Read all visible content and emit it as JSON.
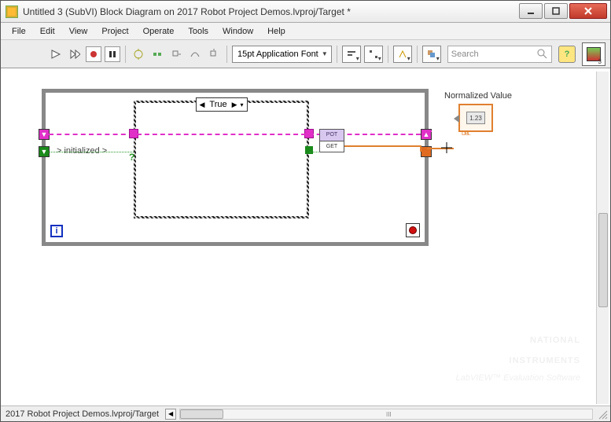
{
  "window": {
    "title": "Untitled 3 (SubVI) Block Diagram on 2017 Robot Project Demos.lvproj/Target *"
  },
  "menu": {
    "file": "File",
    "edit": "Edit",
    "view": "View",
    "project": "Project",
    "operate": "Operate",
    "tools": "Tools",
    "window": "Window",
    "help": "Help"
  },
  "toolbar": {
    "font": "15pt Application Font",
    "search_placeholder": "Search",
    "help": "?"
  },
  "diagram": {
    "case_value": "True",
    "init_label": "> initialized >",
    "pot_top": "POT",
    "pot_bottom": "GET",
    "loop_index": "i",
    "output_label": "Normalized Value",
    "indicator_text": "1.23"
  },
  "status": {
    "path": "2017 Robot Project Demos.lvproj/Target",
    "h_marker": "III"
  },
  "watermark": {
    "line1": "NATIONAL",
    "line2": "INSTRUMENTS",
    "line3": "LabVIEW™ Evaluation Software"
  }
}
